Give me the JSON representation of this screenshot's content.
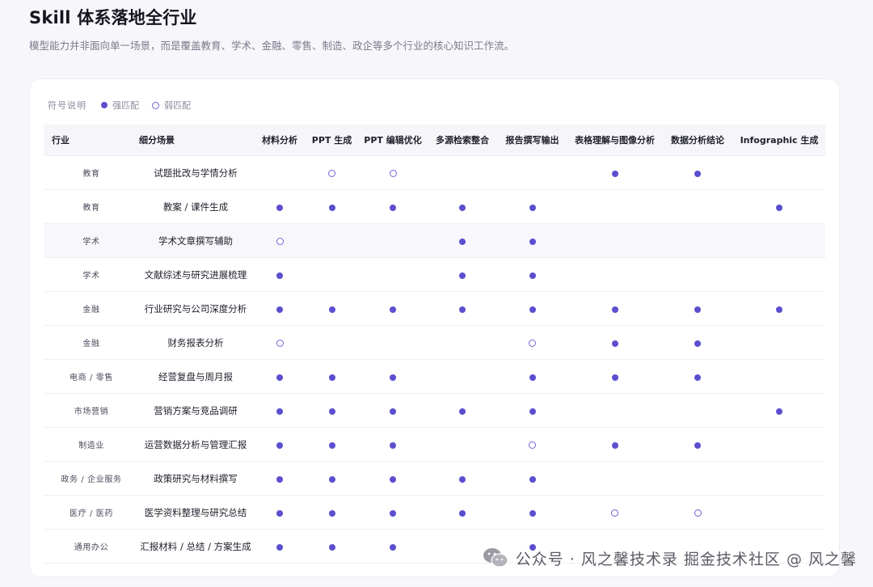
{
  "title": "Skill 体系落地全行业",
  "subtitle": "模型能力并非面向单一场景，而是覆盖教育、学术、金融、零售、制造、政企等多个行业的核心知识工作流。",
  "legend": {
    "label": "符号说明",
    "strong": "强匹配",
    "weak": "弱匹配"
  },
  "table": {
    "columns": [
      "行业",
      "细分场景",
      "材料分析",
      "PPT 生成",
      "PPT 编辑优化",
      "多源检索整合",
      "报告撰写输出",
      "表格理解与图像分析",
      "数据分析结论",
      "Infographic 生成"
    ],
    "rows": [
      {
        "industry": "教育",
        "scene": "试题批改与学情分析",
        "marks": [
          "",
          "weak",
          "weak",
          "",
          "",
          "strong",
          "strong",
          ""
        ]
      },
      {
        "industry": "教育",
        "scene": "教案 / 课件生成",
        "marks": [
          "strong",
          "strong",
          "strong",
          "strong",
          "strong",
          "",
          "",
          "strong"
        ]
      },
      {
        "industry": "学术",
        "scene": "学术文章撰写辅助",
        "marks": [
          "weak",
          "",
          "",
          "strong",
          "strong",
          "",
          "",
          ""
        ]
      },
      {
        "industry": "学术",
        "scene": "文献综述与研究进展梳理",
        "marks": [
          "strong",
          "",
          "",
          "strong",
          "strong",
          "",
          "",
          ""
        ]
      },
      {
        "industry": "金融",
        "scene": "行业研究与公司深度分析",
        "marks": [
          "strong",
          "strong",
          "strong",
          "strong",
          "strong",
          "strong",
          "strong",
          "strong"
        ]
      },
      {
        "industry": "金融",
        "scene": "财务报表分析",
        "marks": [
          "weak",
          "",
          "",
          "",
          "weak",
          "strong",
          "strong",
          ""
        ]
      },
      {
        "industry": "电商 / 零售",
        "scene": "经营复盘与周月报",
        "marks": [
          "strong",
          "strong",
          "strong",
          "",
          "strong",
          "strong",
          "strong",
          ""
        ]
      },
      {
        "industry": "市场营销",
        "scene": "营销方案与竞品调研",
        "marks": [
          "strong",
          "strong",
          "strong",
          "strong",
          "strong",
          "",
          "",
          "strong"
        ]
      },
      {
        "industry": "制造业",
        "scene": "运营数据分析与管理汇报",
        "marks": [
          "strong",
          "strong",
          "strong",
          "",
          "weak",
          "strong",
          "strong",
          ""
        ]
      },
      {
        "industry": "政务 / 企业服务",
        "scene": "政策研究与材料撰写",
        "marks": [
          "strong",
          "strong",
          "strong",
          "strong",
          "strong",
          "",
          "",
          ""
        ]
      },
      {
        "industry": "医疗 / 医药",
        "scene": "医学资料整理与研究总结",
        "marks": [
          "strong",
          "strong",
          "strong",
          "strong",
          "strong",
          "weak",
          "weak",
          ""
        ]
      },
      {
        "industry": "通用办公",
        "scene": "汇报材料 / 总结 / 方案生成",
        "marks": [
          "strong",
          "strong",
          "strong",
          "",
          "strong",
          "",
          "",
          ""
        ]
      }
    ],
    "highlighted_row": 2
  },
  "watermark": {
    "text": "公众号 · 风之馨技术录 掘金技术社区 @ 风之馨",
    "icon": "wechat-icon"
  },
  "colors": {
    "accent": "#5b4fcf",
    "header_bg": "#f6f6fa"
  }
}
